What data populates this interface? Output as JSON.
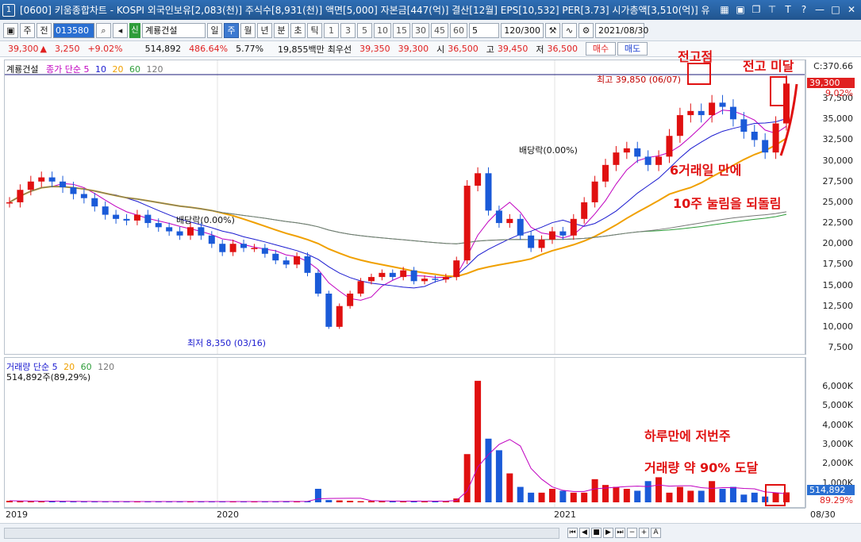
{
  "window": {
    "number": "1",
    "title": "[0600] 키움종합차트 - KOSPI 외국인보유[2,083(천)] 주식수[8,931(천)] 액면[5,000] 자본금[447(억)] 결산[12월] EPS[10,532] PER[3.73] 시가총액[3,510(억)] 유"
  },
  "toolbar": {
    "market": "주",
    "scope": "전",
    "code": "013580",
    "sin_badge": "신",
    "stock_name": "계룡건설",
    "periods": [
      "일",
      "주",
      "월",
      "년",
      "분",
      "초",
      "틱"
    ],
    "active_period": "주",
    "intervals": [
      "1",
      "3",
      "5",
      "10",
      "15",
      "30",
      "45",
      "60"
    ],
    "interval_select": "5",
    "count": "120/300",
    "date": "2021/08/30"
  },
  "info": {
    "price": "39,300",
    "change": "3,250",
    "change_pct": "+9.02%",
    "volume": "514,892",
    "volume_ratio": "486.64%",
    "turnover": "5.77%",
    "amount": "19,855백만",
    "ask_label": "최우선",
    "ask": "39,350",
    "bid": "39,300",
    "open_label": "시",
    "open": "36,500",
    "high_label": "고",
    "high": "39,450",
    "low_label": "저",
    "low": "36,500",
    "buy": "매수",
    "sell": "매도"
  },
  "main_legend": {
    "stock": "계룡건설",
    "ma_label": "종가 단순 5",
    "ma_periods": [
      "10",
      "20",
      "60",
      "120"
    ],
    "ma_colors": [
      "#c000c0",
      "#1b1bd0",
      "#f0a000",
      "#2e9d3a",
      "#777777"
    ]
  },
  "vol_legend": {
    "label": "거래량 단순 5",
    "periods": [
      "20",
      "60",
      "120"
    ],
    "value": "514,892주(89,29%)"
  },
  "price_rail": {
    "top_label": "C:370.66",
    "current": "39,300",
    "current_pct": "9.02%",
    "ticks": [
      "37,500",
      "35,000",
      "32,500",
      "30,000",
      "27,500",
      "25,000",
      "22,500",
      "20,000",
      "17,500",
      "15,000",
      "12,500",
      "10,000",
      "7,500"
    ]
  },
  "vol_rail": {
    "ticks": [
      "6,000K",
      "5,000K",
      "4,000K",
      "3,000K",
      "2,000K",
      "1,000K"
    ],
    "current": "514,892",
    "current_pct": "89.29%"
  },
  "x_axis": {
    "labels": [
      "2019",
      "2020",
      "2021"
    ],
    "end_label": "08/30"
  },
  "chart_labels": {
    "high": "최고 39,850 (06/07)",
    "low": "최저 8,350 (03/16)",
    "div1": "배당락(0.00%)",
    "div2": "배당락(0.00%)"
  },
  "annotations": {
    "prev_high": "전고점",
    "near_prev_high": "전고 미달",
    "six_days": "6거래일 만에",
    "recovered": "10주 눌림을 되돌림",
    "one_day": "하루만에 저번주",
    "volume_reach": "거래량 약 90% 도달"
  },
  "chart_data": {
    "type": "candlestick",
    "x_start": "2019-01",
    "x_end": "2021-08-30",
    "ylim": [
      7500,
      40000
    ],
    "ohlc_weekly_close": [
      25000,
      26500,
      27500,
      28000,
      27500,
      26800,
      26000,
      25500,
      24500,
      23500,
      23000,
      22800,
      23500,
      22500,
      22000,
      21500,
      21000,
      22000,
      21000,
      20000,
      19000,
      20000,
      19500,
      19500,
      18800,
      18000,
      17500,
      18500,
      16500,
      14000,
      10000,
      12500,
      14000,
      15500,
      16000,
      16500,
      16000,
      16800,
      15500,
      15800,
      15700,
      16000,
      18000,
      27000,
      28500,
      24000,
      22500,
      23000,
      21000,
      19500,
      20500,
      21500,
      21000,
      23000,
      25000,
      27500,
      29500,
      31000,
      31500,
      30500,
      29500,
      30500,
      33000,
      35500,
      36000,
      35500,
      37000,
      36500,
      35000,
      33500,
      32500,
      31000,
      34500,
      39300
    ],
    "volume_peak_k": 6300,
    "volume_last": 514892
  }
}
